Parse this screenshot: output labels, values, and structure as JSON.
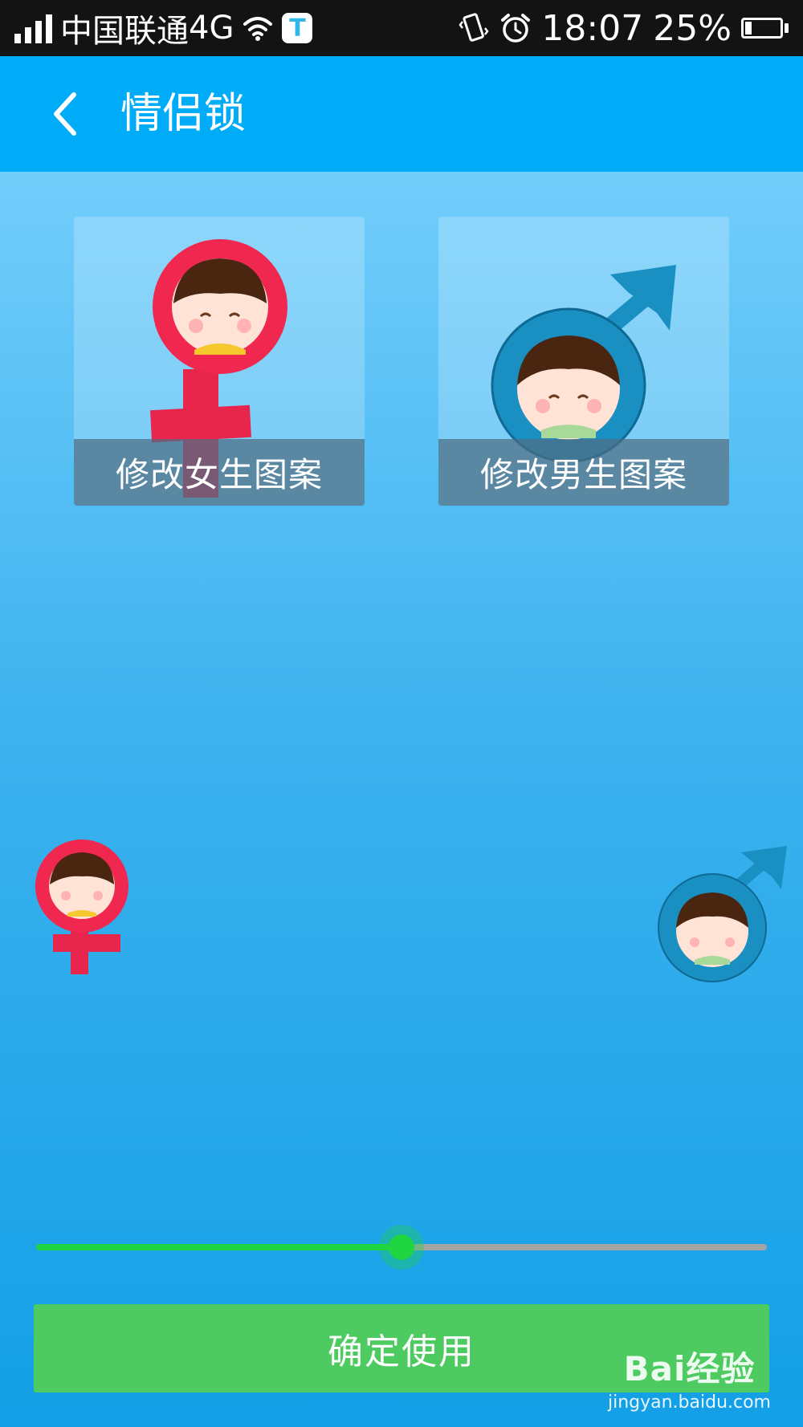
{
  "status_bar": {
    "carrier": "中国联通",
    "network": "4G",
    "time": "18:07",
    "battery_percent": "25%",
    "battery_level": 0.25,
    "icons": [
      "signal-icon",
      "wifi-icon",
      "t-app-icon",
      "vibrate-icon",
      "alarm-icon",
      "battery-icon"
    ]
  },
  "app_bar": {
    "title": "情侣锁",
    "back_icon": "back-arrow-icon"
  },
  "cards": {
    "female": {
      "label": "修改女生图案",
      "icon": "female-symbol-icon"
    },
    "male": {
      "label": "修改男生图案",
      "icon": "male-symbol-icon"
    }
  },
  "slider": {
    "value": 0.5
  },
  "confirm_button": {
    "label": "确定使用"
  },
  "watermark": {
    "logo": "Bai经验",
    "url": "jingyan.baidu.com"
  },
  "colors": {
    "status_bar": "#131313",
    "app_bar": "#00abf8",
    "female": "#f0274f",
    "male": "#1a8fc1",
    "slider_active": "#1fd541",
    "button": "#4dcb60"
  }
}
